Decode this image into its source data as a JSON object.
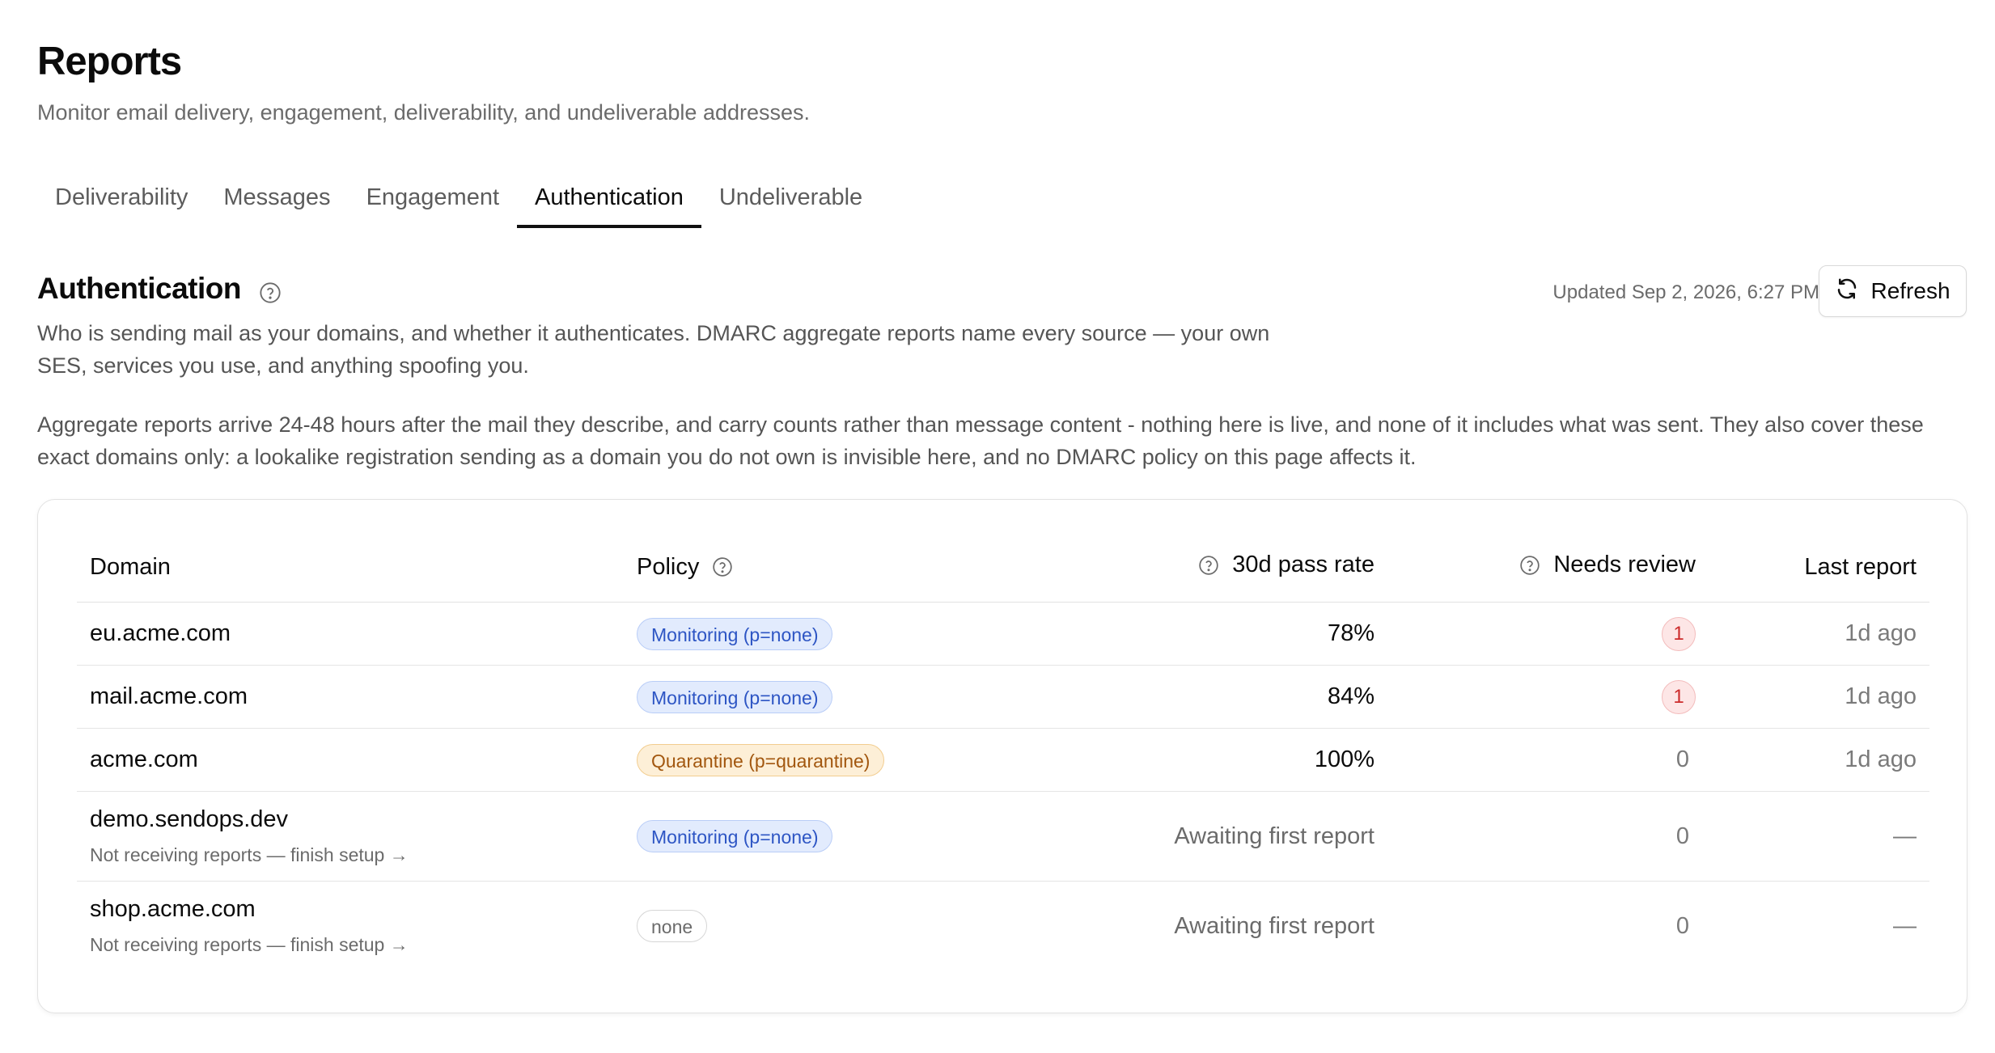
{
  "page": {
    "title": "Reports",
    "subtitle": "Monitor email delivery, engagement, deliverability, and undeliverable addresses."
  },
  "tabs": [
    {
      "label": "Deliverability",
      "active": false
    },
    {
      "label": "Messages",
      "active": false
    },
    {
      "label": "Engagement",
      "active": false
    },
    {
      "label": "Authentication",
      "active": true
    },
    {
      "label": "Undeliverable",
      "active": false
    }
  ],
  "section": {
    "title": "Authentication",
    "help_icon": "question-circle-icon",
    "updated": "Updated Sep 2, 2026, 6:27 PM",
    "refresh_label": "Refresh",
    "refresh_icon": "refresh-icon",
    "description": "Who is sending mail as your domains, and whether it authenticates. DMARC aggregate reports name every source — your own SES, services you use, and anything spoofing you.",
    "note": "Aggregate reports arrive 24-48 hours after the mail they describe, and carry counts rather than message content - nothing here is live, and none of it includes what was sent. They also cover these exact domains only: a lookalike registration sending as a domain you do not own is invisible here, and no DMARC policy on this page affects it."
  },
  "table": {
    "headers": {
      "domain": "Domain",
      "policy": "Policy",
      "pass_rate": "30d pass rate",
      "needs_review": "Needs review",
      "last_report": "Last report"
    },
    "rows": [
      {
        "domain": "eu.acme.com",
        "setup": "",
        "policy": "Monitoring (p=none)",
        "policy_kind": "monitor",
        "pass_rate": "78%",
        "needs_review": "1",
        "last_report": "1d ago"
      },
      {
        "domain": "mail.acme.com",
        "setup": "",
        "policy": "Monitoring (p=none)",
        "policy_kind": "monitor",
        "pass_rate": "84%",
        "needs_review": "1",
        "last_report": "1d ago"
      },
      {
        "domain": "acme.com",
        "setup": "",
        "policy": "Quarantine (p=quarantine)",
        "policy_kind": "quarantine",
        "pass_rate": "100%",
        "needs_review": "0",
        "last_report": "1d ago"
      },
      {
        "domain": "demo.sendops.dev",
        "setup": "Not receiving reports — finish setup →",
        "policy": "Monitoring (p=none)",
        "policy_kind": "monitor",
        "pass_rate": "Awaiting first report",
        "needs_review": "0",
        "last_report": "—"
      },
      {
        "domain": "shop.acme.com",
        "setup": "Not receiving reports — finish setup →",
        "policy": "none",
        "policy_kind": "none",
        "pass_rate": "Awaiting first report",
        "needs_review": "0",
        "last_report": "—"
      }
    ]
  },
  "colors": {
    "monitor_badge": "#e2ebfd",
    "quarantine_badge": "#fdefd7",
    "review_alert": "#fde6e6"
  }
}
